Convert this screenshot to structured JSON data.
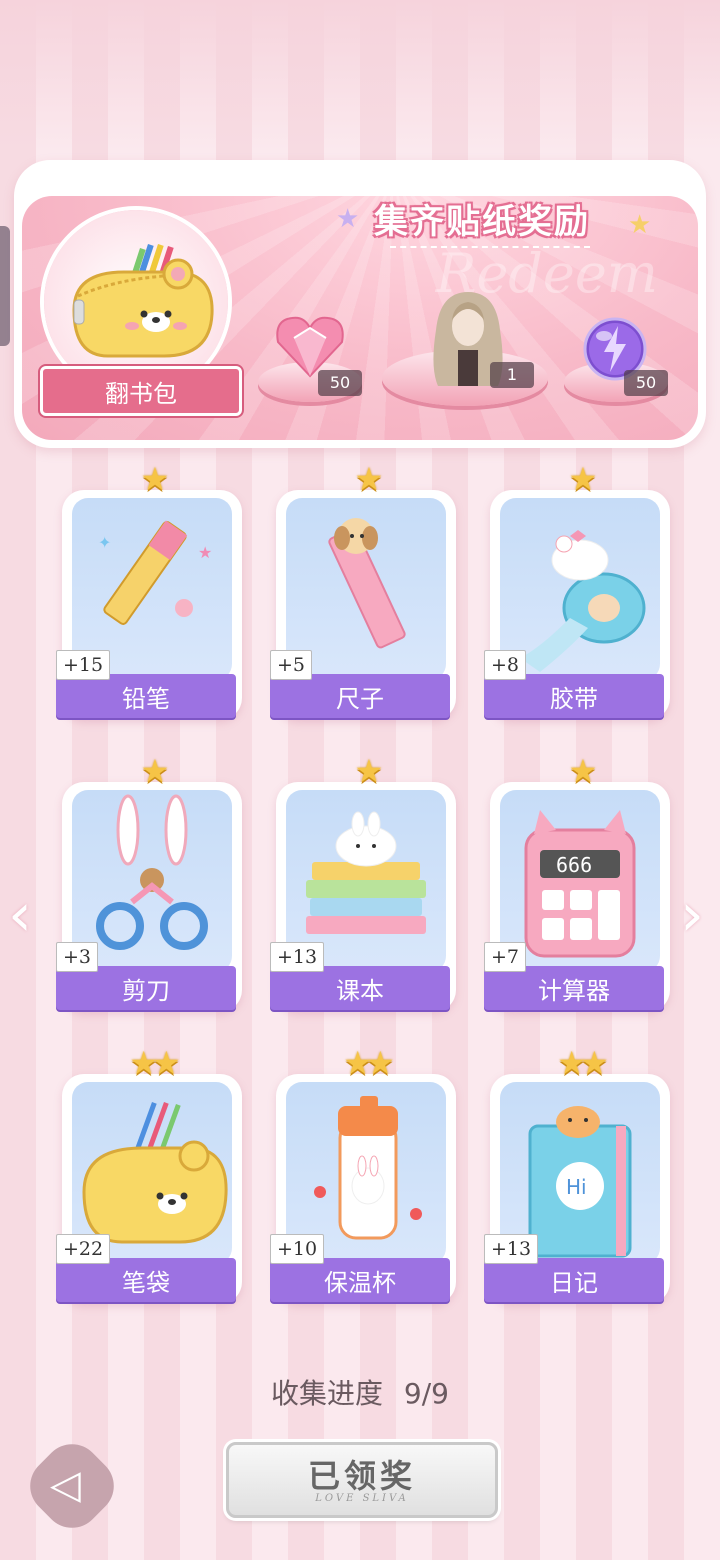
{
  "banner": {
    "title": "集齐贴纸奖励",
    "watermark": "Redeem",
    "main_reward_label": "翻书包",
    "rewards": [
      {
        "icon": "pink-heart-gem-icon",
        "count": "50"
      },
      {
        "icon": "girl-outfit-icon",
        "count": "1"
      },
      {
        "icon": "purple-energy-orb-icon",
        "count": "50"
      }
    ]
  },
  "stickers": [
    {
      "name": "铅笔",
      "bonus": "+15",
      "stars": "★",
      "icon": "pencil-icon"
    },
    {
      "name": "尺子",
      "bonus": "+5",
      "stars": "★",
      "icon": "ruler-icon"
    },
    {
      "name": "胶带",
      "bonus": "+8",
      "stars": "★",
      "icon": "tape-icon"
    },
    {
      "name": "剪刀",
      "bonus": "+3",
      "stars": "★",
      "icon": "scissors-icon"
    },
    {
      "name": "课本",
      "bonus": "+13",
      "stars": "★",
      "icon": "textbook-icon"
    },
    {
      "name": "计算器",
      "bonus": "+7",
      "stars": "★",
      "icon": "calculator-icon"
    },
    {
      "name": "笔袋",
      "bonus": "+22",
      "stars": "★★",
      "icon": "pencil-case-icon"
    },
    {
      "name": "保温杯",
      "bonus": "+10",
      "stars": "★★",
      "icon": "thermos-icon"
    },
    {
      "name": "日记",
      "bonus": "+13",
      "stars": "★★",
      "icon": "diary-icon"
    }
  ],
  "progress": {
    "label": "收集进度",
    "value": "9/9"
  },
  "claim_button": {
    "label": "已领奖",
    "sub": "LOVE SLIVA"
  },
  "colors": {
    "accent_purple": "#9c72e2",
    "accent_pink": "#e56d8c",
    "gold": "#f6c446"
  }
}
